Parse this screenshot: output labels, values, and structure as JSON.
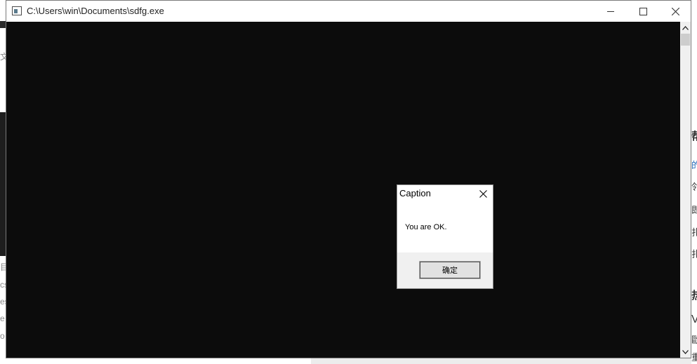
{
  "window": {
    "title": "C:\\Users\\win\\Documents\\sdfg.exe"
  },
  "message_box": {
    "caption": "Caption",
    "message": "You are OK.",
    "ok_label": "确定"
  },
  "background": {
    "left_fragments": [
      "文",
      "目",
      "cs",
      "es",
      "e",
      "o"
    ],
    "right_fragments": [
      "帮",
      "的",
      "邻",
      "即",
      "扎",
      "扎",
      "热",
      "V",
      "歐",
      "重"
    ]
  },
  "icons": {
    "app": "console-app-icon",
    "minimize": "minimize-icon",
    "maximize": "maximize-icon",
    "close": "close-icon",
    "scroll_up": "chevron-up-icon",
    "scroll_down": "chevron-down-icon",
    "dialog_close": "close-icon"
  },
  "colors": {
    "console_bg": "#0c0c0c",
    "titlebar_bg": "#ffffff",
    "dialog_footer_bg": "#f0f0f0",
    "button_bg": "#e1e1e1"
  }
}
